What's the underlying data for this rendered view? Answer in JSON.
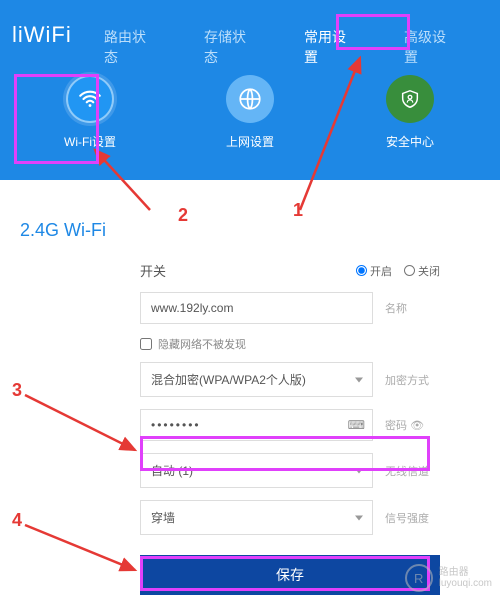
{
  "logo": "liWiFi",
  "nav": [
    {
      "label": "路由状态"
    },
    {
      "label": "存储状态"
    },
    {
      "label": "常用设置"
    },
    {
      "label": "高级设置"
    }
  ],
  "iconRow": {
    "wifi": "Wi-Fi设置",
    "net": "上网设置",
    "sec": "安全中心"
  },
  "sectionTitle": "2.4G Wi-Fi",
  "form": {
    "switchLabel": "开关",
    "radioOn": "开启",
    "radioOff": "关闭",
    "ssidValue": "www.192ly.com",
    "ssidLabel": "名称",
    "hideLabel": "隐藏网络不被发现",
    "encryptValue": "混合加密(WPA/WPA2个人版)",
    "encryptLabel": "加密方式",
    "pwdValue": "••••••••",
    "pwdLabel": "密码",
    "channelValue": "自动 (1)",
    "channelLabel": "无线信道",
    "signalValue": "穿墙",
    "signalLabel": "信号强度",
    "saveLabel": "保存"
  },
  "annotations": {
    "n1": "1",
    "n2": "2",
    "n3": "3",
    "n4": "4"
  },
  "watermark": {
    "icon": "R",
    "line1": "路由器",
    "line2": "luyouqi.com"
  }
}
